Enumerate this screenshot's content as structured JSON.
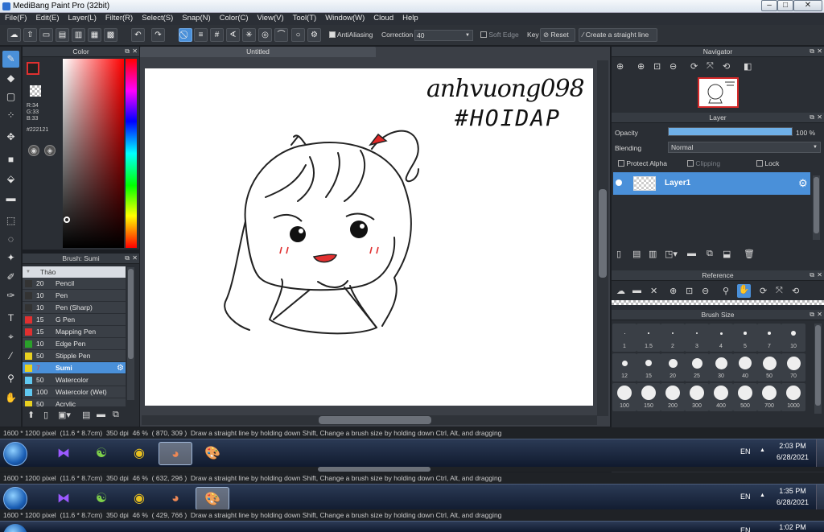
{
  "window": {
    "title": "MediBang Paint Pro (32bit)"
  },
  "menu": [
    "File(F)",
    "Edit(E)",
    "Layer(L)",
    "Filter(R)",
    "Select(S)",
    "Snap(N)",
    "Color(C)",
    "View(V)",
    "Tool(T)",
    "Window(W)",
    "Cloud",
    "Help"
  ],
  "toolbar": {
    "antialiasing_label": "AntiAliasing",
    "correction_label": "Correction",
    "correction_value": "40",
    "soft_edge_label": "Soft Edge",
    "key_label": "Key",
    "reset_label": "Reset",
    "straight_line_label": "Create a straight line"
  },
  "color_panel": {
    "title": "Color",
    "rgb_r": "R:34",
    "rgb_g": "G:33",
    "rgb_b": "B:33",
    "hex": "#222121",
    "fg_color": "#222121"
  },
  "brush_panel": {
    "title": "Brush: Sumi",
    "group": "Thảo",
    "items": [
      {
        "size": "20",
        "name": "Pencil",
        "color": "#333333"
      },
      {
        "size": "10",
        "name": "Pen",
        "color": "#333333"
      },
      {
        "size": "10",
        "name": "Pen (Sharp)",
        "color": "#333333"
      },
      {
        "size": "15",
        "name": "G Pen",
        "color": "#e03030"
      },
      {
        "size": "15",
        "name": "Mapping Pen",
        "color": "#e03030"
      },
      {
        "size": "10",
        "name": "Edge Pen",
        "color": "#2aa02a"
      },
      {
        "size": "50",
        "name": "Stipple Pen",
        "color": "#e8d020"
      },
      {
        "size": "7",
        "name": "Sumi",
        "color": "#e8d020"
      },
      {
        "size": "50",
        "name": "Watercolor",
        "color": "#60c8f0"
      },
      {
        "size": "100",
        "name": "Watercolor (Wet)",
        "color": "#60c8f0"
      },
      {
        "size": "50",
        "name": "Acrylic",
        "color": "#e8d020"
      }
    ]
  },
  "document": {
    "tab": "Untitled",
    "handwriting_line1": "anhvuong098",
    "handwriting_line2": "#HOIDAP"
  },
  "navigator": {
    "title": "Navigator"
  },
  "layer_panel": {
    "title": "Layer",
    "opacity_label": "Opacity",
    "opacity_value": "100 %",
    "opacity_fraction": 1.0,
    "blending_label": "Blending",
    "blending_value": "Normal",
    "protect_alpha": "Protect Alpha",
    "clipping": "Clipping",
    "lock": "Lock",
    "layer_name": "Layer1"
  },
  "reference_panel": {
    "title": "Reference"
  },
  "brush_size_panel": {
    "title": "Brush Size",
    "sizes": [
      "1",
      "1.5",
      "2",
      "3",
      "4",
      "5",
      "7",
      "10",
      "12",
      "15",
      "20",
      "25",
      "30",
      "40",
      "50",
      "70",
      "100",
      "150",
      "200",
      "300",
      "400",
      "500",
      "700",
      "1000"
    ]
  },
  "status_lines": [
    {
      "dims": "1600 * 1200 pixel",
      "cm": "(11.6 * 8.7cm)",
      "dpi": "350 dpi",
      "zoom": "46 %",
      "coords": "( 870, 309 )",
      "hint": "Draw a straight line by holding down Shift, Change a brush size by holding down Ctrl, Alt, and dragging"
    },
    {
      "dims": "1600 * 1200 pixel",
      "cm": "(11.6 * 8.7cm)",
      "dpi": "350 dpi",
      "zoom": "46 %",
      "coords": "( 632, 296 )",
      "hint": "Draw a straight line by holding down Shift, Change a brush size by holding down Ctrl, Alt, and dragging"
    },
    {
      "dims": "1600 * 1200 pixel",
      "cm": "(11.6 * 8.7cm)",
      "dpi": "350 dpi",
      "zoom": "46 %",
      "coords": "( 429, 766 )",
      "hint": "Draw a straight line by holding down Shift, Change a brush size by holding down Ctrl, Alt, and dragging"
    }
  ],
  "taskbars": [
    {
      "lang": "EN",
      "time": "2:03 PM",
      "date": "6/28/2021"
    },
    {
      "lang": "EN",
      "time": "1:35 PM",
      "date": "6/28/2021"
    },
    {
      "lang": "EN",
      "time": "1:02 PM",
      "date": ""
    }
  ]
}
